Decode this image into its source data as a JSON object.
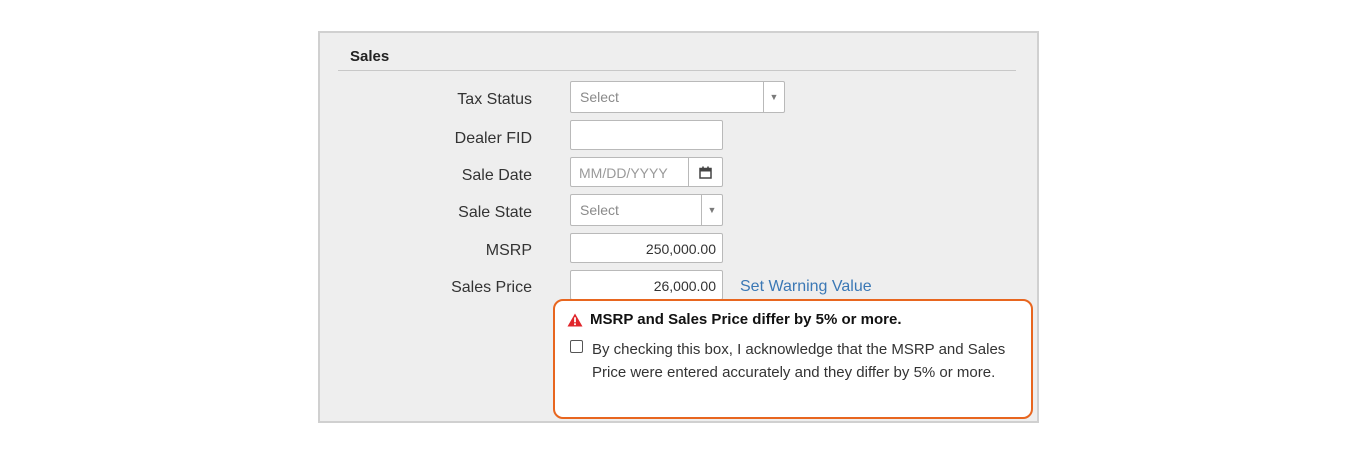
{
  "section": {
    "title": "Sales"
  },
  "fields": {
    "tax_status": {
      "label": "Tax Status",
      "value": "Select"
    },
    "dealer_fid": {
      "label": "Dealer FID",
      "value": ""
    },
    "sale_date": {
      "label": "Sale Date",
      "placeholder": "MM/DD/YYYY"
    },
    "sale_state": {
      "label": "Sale State",
      "value": "Select"
    },
    "msrp": {
      "label": "MSRP",
      "value": "250,000.00"
    },
    "sales_price": {
      "label": "Sales Price",
      "value": "26,000.00"
    }
  },
  "set_warning_link": "Set Warning Value",
  "warning": {
    "title": "MSRP and Sales Price differ by 5% or more.",
    "acknowledge_text": "By checking this box, I acknowledge that the MSRP and Sales Price were entered accurately and they differ by 5% or more.",
    "checked": false
  },
  "colors": {
    "warning_border": "#e8661f",
    "warning_icon": "#e0262b",
    "link": "#3b78b5"
  },
  "icons": {
    "calendar": "calendar-icon",
    "warning": "warning-triangle-icon",
    "dropdown": "chevron-down-icon"
  }
}
